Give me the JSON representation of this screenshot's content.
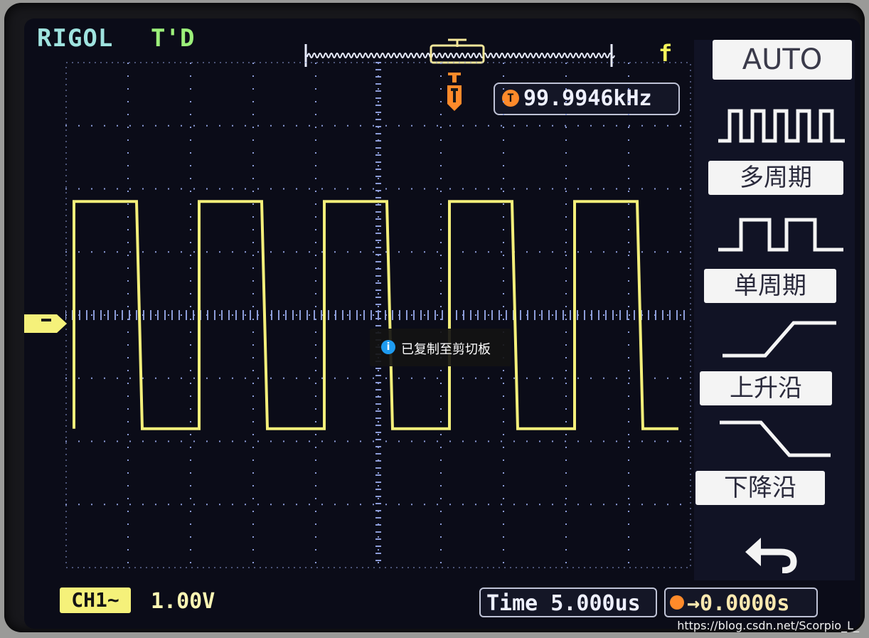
{
  "header": {
    "brand": "RIGOL",
    "trigger_status": "T'D",
    "trigger_slope_symbol": "f"
  },
  "measurement": {
    "frequency": "99.9946kHz",
    "frequency_icon": "T"
  },
  "menu": {
    "mode": "AUTO",
    "items": [
      {
        "label": "多周期",
        "icon": "multi-period-wave-icon"
      },
      {
        "label": "单周期",
        "icon": "single-period-wave-icon"
      },
      {
        "label": "上升沿",
        "icon": "rising-edge-icon"
      },
      {
        "label": "下降沿",
        "icon": "falling-edge-icon"
      }
    ],
    "back_icon": "return-arrow-icon"
  },
  "status_bar": {
    "channel": "CH1~",
    "volts_per_div": "1.00V",
    "timebase": "Time 5.000us",
    "trigger_offset": "→0.0000s"
  },
  "waveform": {
    "type": "square",
    "frequency_khz": 99.9946,
    "period_us": 10,
    "visible_cycles": 5,
    "high_level_div": 1.8,
    "low_level_div": -1.8,
    "color": "#f4ef7a"
  },
  "toast": {
    "icon": "info-icon",
    "text": "已复制至剪切板"
  },
  "watermark": "https://blog.csdn.net/Scorpio_L_",
  "colors": {
    "trace": "#f4ef7a",
    "grid": "#8c9cd8",
    "trigger_marker": "#ff8a2a",
    "brand": "#9fe3df",
    "status_ok": "#9cf07a"
  }
}
